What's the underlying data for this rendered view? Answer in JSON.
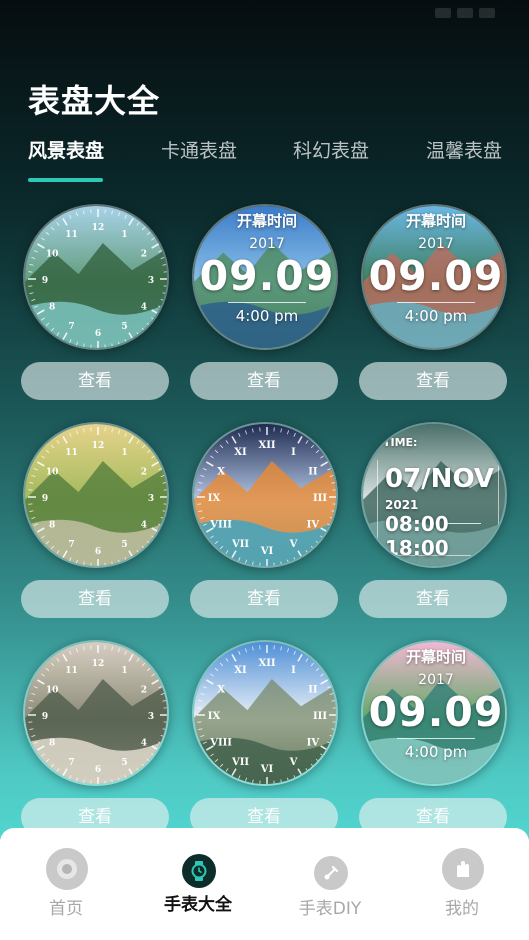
{
  "header": {
    "title": "表盘大全"
  },
  "tabs": [
    {
      "label": "风景表盘",
      "active": true
    },
    {
      "label": "卡通表盘",
      "active": false
    },
    {
      "label": "科幻表盘",
      "active": false
    },
    {
      "label": "温馨表盘",
      "active": false
    }
  ],
  "cards": [
    {
      "style": "analog",
      "button": "查看"
    },
    {
      "style": "digital",
      "top": "开幕时间",
      "year": "2017",
      "big": "09.09",
      "time": "4:00 pm",
      "button": "查看"
    },
    {
      "style": "digital",
      "top": "开幕时间",
      "year": "2017",
      "big": "09.09",
      "time": "4:00 pm",
      "button": "查看"
    },
    {
      "style": "analog",
      "button": "查看"
    },
    {
      "style": "roman",
      "button": "查看"
    },
    {
      "style": "time",
      "label": "TIME:",
      "date": "07/NOV",
      "year": "2021",
      "t1": "08:00",
      "t2": "18:00",
      "button": "查看"
    },
    {
      "style": "analog",
      "button": "查看"
    },
    {
      "style": "roman",
      "button": "查看"
    },
    {
      "style": "digital",
      "top": "开幕时间",
      "year": "2017",
      "big": "09.09",
      "time": "4:00 pm",
      "button": "查看"
    }
  ],
  "bottom_nav": [
    {
      "label": "首页",
      "icon": "home-icon",
      "active": false
    },
    {
      "label": "手表大全",
      "icon": "watch-icon",
      "active": true
    },
    {
      "label": "手表DIY",
      "icon": "diy-icon",
      "active": false
    },
    {
      "label": "我的",
      "icon": "profile-icon",
      "active": false
    }
  ],
  "colors": {
    "accent": "#2ec9b6",
    "nav_active": "#0d2c2a"
  }
}
